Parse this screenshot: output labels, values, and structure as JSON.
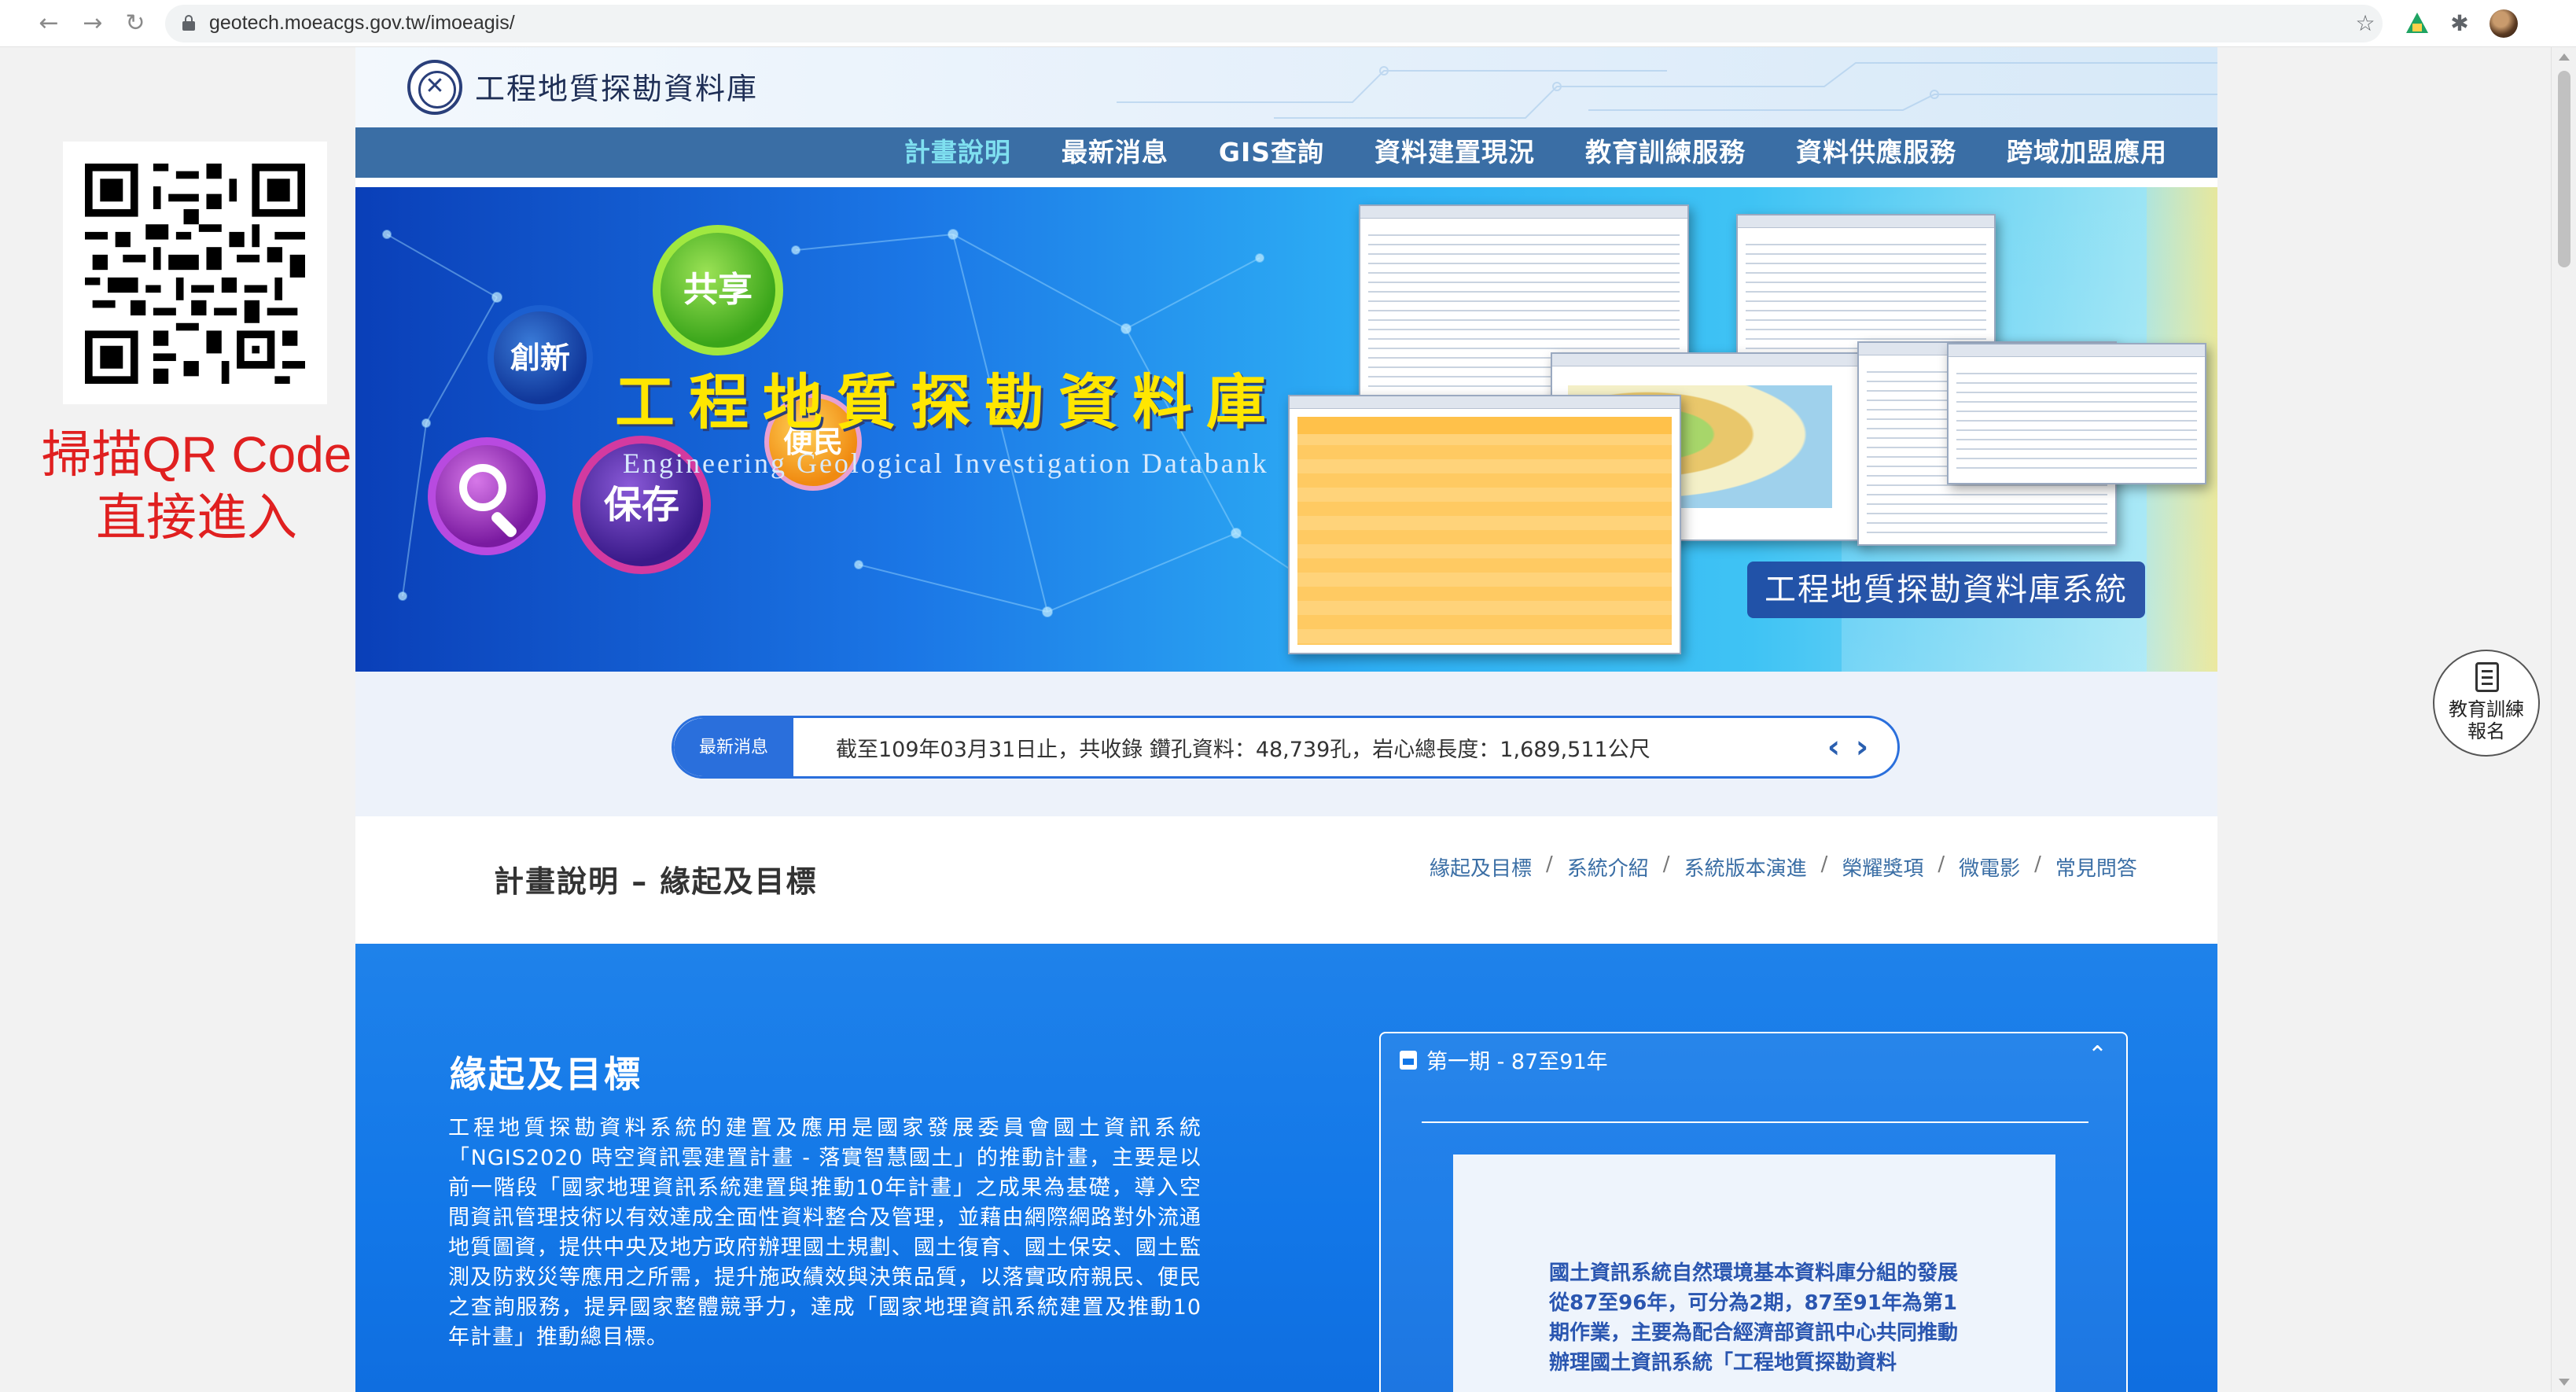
{
  "browser": {
    "url": "geotech.moeacgs.gov.tw/imoeagis/",
    "icons": [
      "back-arrow-icon",
      "forward-arrow-icon",
      "reload-icon",
      "lock-icon",
      "star-icon",
      "drive-icon",
      "extensions-icon",
      "avatar"
    ]
  },
  "qr_panel": {
    "scan_line1": "掃描QR Code",
    "scan_line2": "直接進入",
    "color": "#e02020"
  },
  "header": {
    "site_title": "工程地質探勘資料庫"
  },
  "nav": {
    "items": [
      {
        "label": "計畫說明",
        "active": true
      },
      {
        "label": "最新消息"
      },
      {
        "label": "GIS查詢"
      },
      {
        "label": "資料建置現況"
      },
      {
        "label": "教育訓練服務"
      },
      {
        "label": "資料供應服務"
      },
      {
        "label": "跨域加盟應用"
      }
    ],
    "bg_color": "#3a6ea5",
    "active_color": "#7fe0f0"
  },
  "banner": {
    "bubbles": {
      "innovate": "創新",
      "share": "共享",
      "preserve": "保存",
      "convenient": "便民"
    },
    "title": "工程地質探勘資料庫",
    "subtitle": "Engineering Geological Investigation Databank",
    "caption": "工程地質探勘資料庫系統"
  },
  "news": {
    "badge": "最新消息",
    "text": "截至109年03月31日止，共收錄 鑽孔資料：48,739孔，岩心總長度：1,689,511公尺",
    "prev": "‹",
    "next": "›"
  },
  "section": {
    "title": "計畫說明 – 緣起及目標",
    "subnav": [
      "緣起及目標",
      "系統介紹",
      "系統版本演進",
      "榮耀獎項",
      "微電影",
      "常見問答"
    ],
    "separator": "/"
  },
  "intro": {
    "title": "緣起及目標",
    "body": "工程地質探勘資料系統的建置及應用是國家發展委員會國土資訊系統「NGIS2020 時空資訊雲建置計畫 - 落實智慧國土」的推動計畫，主要是以前一階段「國家地理資訊系統建置與推動10年計畫」之成果為基礎，導入空間資訊管理技術以有效達成全面性資料整合及管理，並藉由網際網路對外流通地質圖資，提供中央及地方政府辦理國土規劃、國土復育、國土保安、國土監測及防救災等應用之所需，提升施政績效與決策品質，以落實政府親民、便民之查詢服務，提昇國家整體競爭力，達成「國家地理資訊系統建置及推動10年計畫」推動總目標。"
  },
  "phase": {
    "heading": "第一期 - 87至91年",
    "caret": "⌃",
    "text": "國土資訊系統自然環境基本資料庫分組的發展從87至96年，可分為2期，87至91年為第1期作業，主要為配合經濟部資訊中心共同推動辦理國土資訊系統「工程地質探勘資料"
  },
  "float_button": {
    "line1": "教育訓練",
    "line2": "報名"
  }
}
